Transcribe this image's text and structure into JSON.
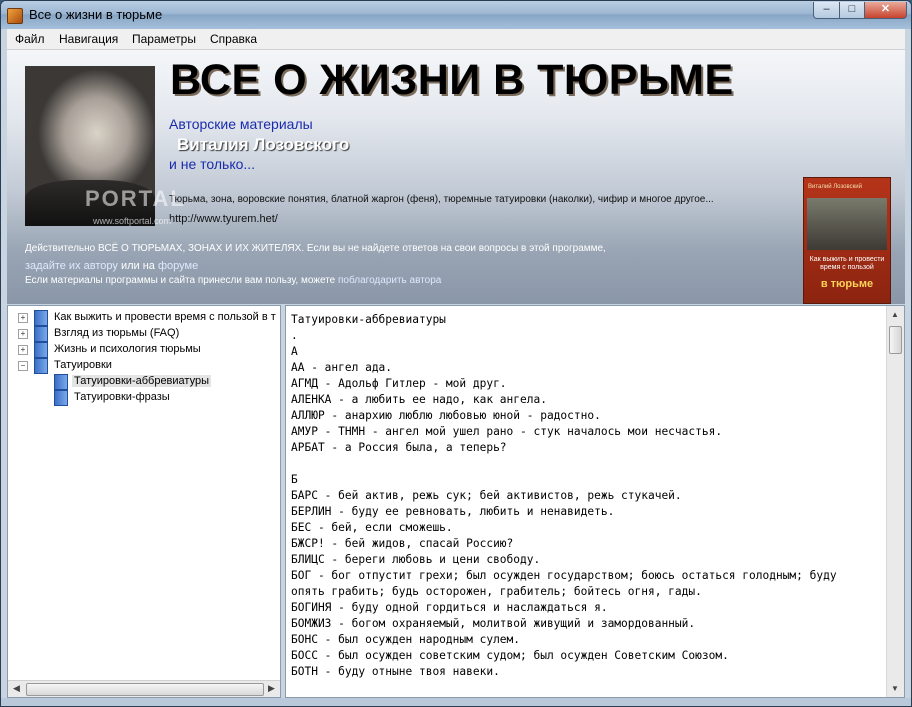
{
  "window": {
    "title": "Все о жизни в тюрьме"
  },
  "menu": [
    "Файл",
    "Навигация",
    "Параметры",
    "Справка"
  ],
  "header": {
    "title": "ВСЕ О ЖИЗНИ В ТЮРЬМЕ",
    "sub1": "Авторские материалы",
    "sub2": "Виталия Лозовского",
    "sub3": "и не только...",
    "desc": "Тюрьма, зона, воровские понятия, блатной жаргон (феня), тюремные татуировки (наколки), чифир и многое другое...",
    "url": "http://www.tyurem.het/",
    "line1": "Действительно ВСЁ О ТЮРЬМАХ, ЗОНАХ И ИХ ЖИТЕЛЯХ. Если вы не найдете ответов на свои вопросы в этой программе,",
    "line2_link1": "задайте их автору",
    "line2_mid": "или на",
    "line2_link2": "форуме",
    "line3_text": "Если материалы программы и сайта принесли вам пользу, можете",
    "line3_link": "поблагодарить автора",
    "watermark": "PORTAL",
    "watermark_sub": "www.softportal.com",
    "book": {
      "author": "Виталий Лозовский",
      "small": "Как выжить и провести время с пользой",
      "big": "в тюрьме"
    }
  },
  "tree": [
    {
      "label": "Как выжить и провести время  с пользой в т",
      "expander": "+",
      "level": 0,
      "selected": false
    },
    {
      "label": "Взгляд из тюрьмы (FAQ)",
      "expander": "+",
      "level": 0,
      "selected": false
    },
    {
      "label": "Жизнь и психология тюрьмы",
      "expander": "+",
      "level": 0,
      "selected": false
    },
    {
      "label": "Татуировки",
      "expander": "−",
      "level": 0,
      "selected": false
    },
    {
      "label": "Татуировки-аббревиатуры",
      "expander": "",
      "level": 1,
      "selected": true
    },
    {
      "label": "Татуировки-фразы",
      "expander": "",
      "level": 1,
      "selected": false
    }
  ],
  "content": {
    "lines": [
      "Татуировки-аббревиатуры",
      ".",
      "А",
      "АА - ангел ада.",
      "АГМД - Адольф Гитлер - мой друг.",
      "АЛЕНКА - а любить ее надо, как ангела.",
      "АЛЛЮР - анархию люблю любовью юной - радостно.",
      "АМУР - ТНМН - ангел мой ушел рано - стук началось мои несчастья.",
      "АРБАТ - а Россия была, а теперь?",
      "",
      "Б",
      "БАРС - бей актив, режь сук; бей активистов, режь стукачей.",
      "БЕРЛИН - буду ее ревновать, любить и ненавидеть.",
      "БЕС - бей, если сможешь.",
      "БЖСР! - бей жидов, спасай Россию?",
      "БЛИЦС - береги любовь и цени свободу.",
      "БОГ - бог отпустит грехи; был осужден государством; боюсь остаться голодным; буду опять грабить; будь осторожен, грабитель; бойтесь огня, гады.",
      "БОГИНЯ - буду одной гордиться и наслаждаться я.",
      "БОМЖИЗ - богом охраняемый, молитвой живущий и замордованный.",
      "БОНС - был осужден народным сулем.",
      "БОСС - был осужден советским судом; был осужден Советским Союзом.",
      "БОТН - буду отныне твоя навеки."
    ]
  },
  "colors": {
    "accent_link": "#1a2cae",
    "book": "#b53419"
  }
}
